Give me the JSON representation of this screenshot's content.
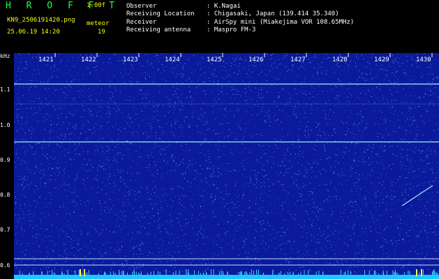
{
  "app": {
    "logo": "H R O F F T",
    "version": "1.00f",
    "filename": "KN9_2506191420.png",
    "mode": "meteor",
    "datetime": "25.06.19 14:20",
    "count": "19"
  },
  "station": {
    "observer_label": "Observer",
    "observer_value": ": K.Nagai",
    "location_label": "Receiving Location",
    "location_value": ": Chigasaki, Japan (139.414 35.340)",
    "receiver_label": "Receiver",
    "receiver_value": ": AirSpy mini (Miakejima VOR 108.65MHz)",
    "antenna_label": "Receiving antenna",
    "antenna_value": ": Maspro FM-3"
  },
  "spectrogram": {
    "y_unit": "kHz",
    "y_ticks": [
      "1.1",
      "1.0",
      "0.9",
      "0.8",
      "0.7",
      "0.6"
    ],
    "x_ticks": [
      "1421",
      "1422",
      "1423",
      "1424",
      "1425",
      "1426",
      "1427",
      "1428",
      "1429",
      "1430"
    ],
    "background_color": "#0a1a9a",
    "noise_color": "#6fb0ff",
    "trace_color": "#9ff0ff"
  }
}
